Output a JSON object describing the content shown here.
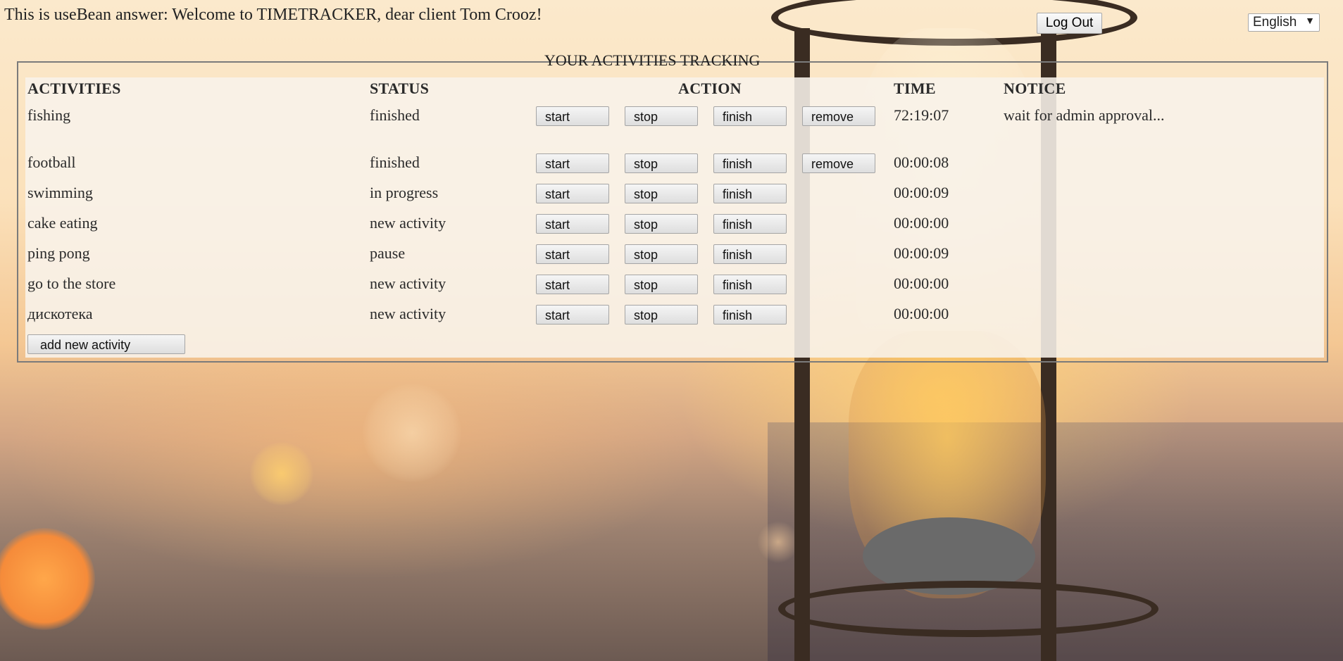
{
  "header": {
    "welcome": "This is useBean answer: Welcome to TIMETRACKER, dear client Tom Crooz!",
    "logout_label": "Log Out",
    "language": "English",
    "language_arrow": "▼"
  },
  "panel": {
    "legend": "YOUR ACTIVITIES TRACKING",
    "columns": {
      "activities": "ACTIVITIES",
      "status": "STATUS",
      "action": "ACTION",
      "time": "TIME",
      "notice": "NOTICE"
    },
    "button_labels": {
      "start": "start",
      "stop": "stop",
      "finish": "finish",
      "remove": "remove"
    },
    "rows": [
      {
        "activity": "fishing",
        "status": "finished",
        "time": "72:19:07",
        "notice": "wait for admin approval..."
      },
      {
        "activity": "football",
        "status": "finished",
        "time": "00:00:08",
        "notice": ""
      },
      {
        "activity": "swimming",
        "status": "in progress",
        "time": "00:00:09",
        "notice": ""
      },
      {
        "activity": "cake eating",
        "status": "new activity",
        "time": "00:00:00",
        "notice": ""
      },
      {
        "activity": "ping pong",
        "status": "pause",
        "time": "00:00:09",
        "notice": ""
      },
      {
        "activity": "go to the store",
        "status": "new activity",
        "time": "00:00:00",
        "notice": ""
      },
      {
        "activity": "дискотека",
        "status": "new activity",
        "time": "00:00:00",
        "notice": ""
      }
    ],
    "add_label": "add new activity"
  }
}
